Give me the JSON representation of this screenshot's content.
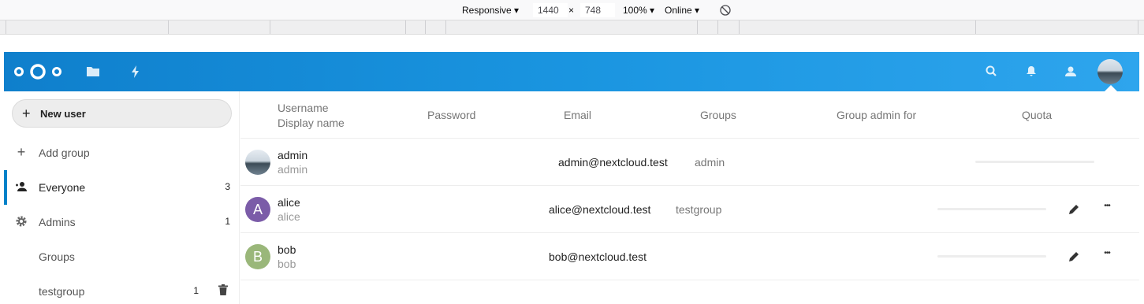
{
  "devtools": {
    "device": "Responsive",
    "width": "1440",
    "times": "×",
    "height": "748",
    "zoom": "100%",
    "network": "Online",
    "dropdown_glyph": "▾",
    "rotate_icon": "rotate-icon"
  },
  "header": {
    "logo_icon": "nextcloud-logo",
    "apps": [
      "files-icon",
      "activity-icon"
    ],
    "right_icons": [
      "search-icon",
      "notifications-icon",
      "contacts-icon"
    ],
    "accent": "#0082c9"
  },
  "sidebar": {
    "new_user_label": "New user",
    "new_user_icon": "+",
    "add_group_label": "Add group",
    "items": [
      {
        "label": "Everyone",
        "count": "3"
      },
      {
        "label": "Admins",
        "count": "1"
      },
      {
        "label": "Groups",
        "count": ""
      },
      {
        "label": "testgroup",
        "count": "1"
      }
    ]
  },
  "table": {
    "columns": {
      "username": "Username",
      "display_name": "Display name",
      "password": "Password",
      "email": "Email",
      "groups": "Groups",
      "group_admin": "Group admin for",
      "quota": "Quota"
    },
    "rows": [
      {
        "username": "admin",
        "display_name": "admin",
        "email": "admin@nextcloud.test",
        "groups": "admin",
        "avatar": "",
        "avatar_color": "photo"
      },
      {
        "username": "alice",
        "display_name": "alice",
        "email": "alice@nextcloud.test",
        "groups": "testgroup",
        "avatar": "A",
        "avatar_color": "#7b5ca8"
      },
      {
        "username": "bob",
        "display_name": "bob",
        "email": "bob@nextcloud.test",
        "groups": "",
        "avatar": "B",
        "avatar_color": "#9ab77a"
      }
    ],
    "row_actions": {
      "edit_icon": "pencil-icon",
      "more_icon": "more-icon",
      "more_glyph": "•••"
    }
  }
}
